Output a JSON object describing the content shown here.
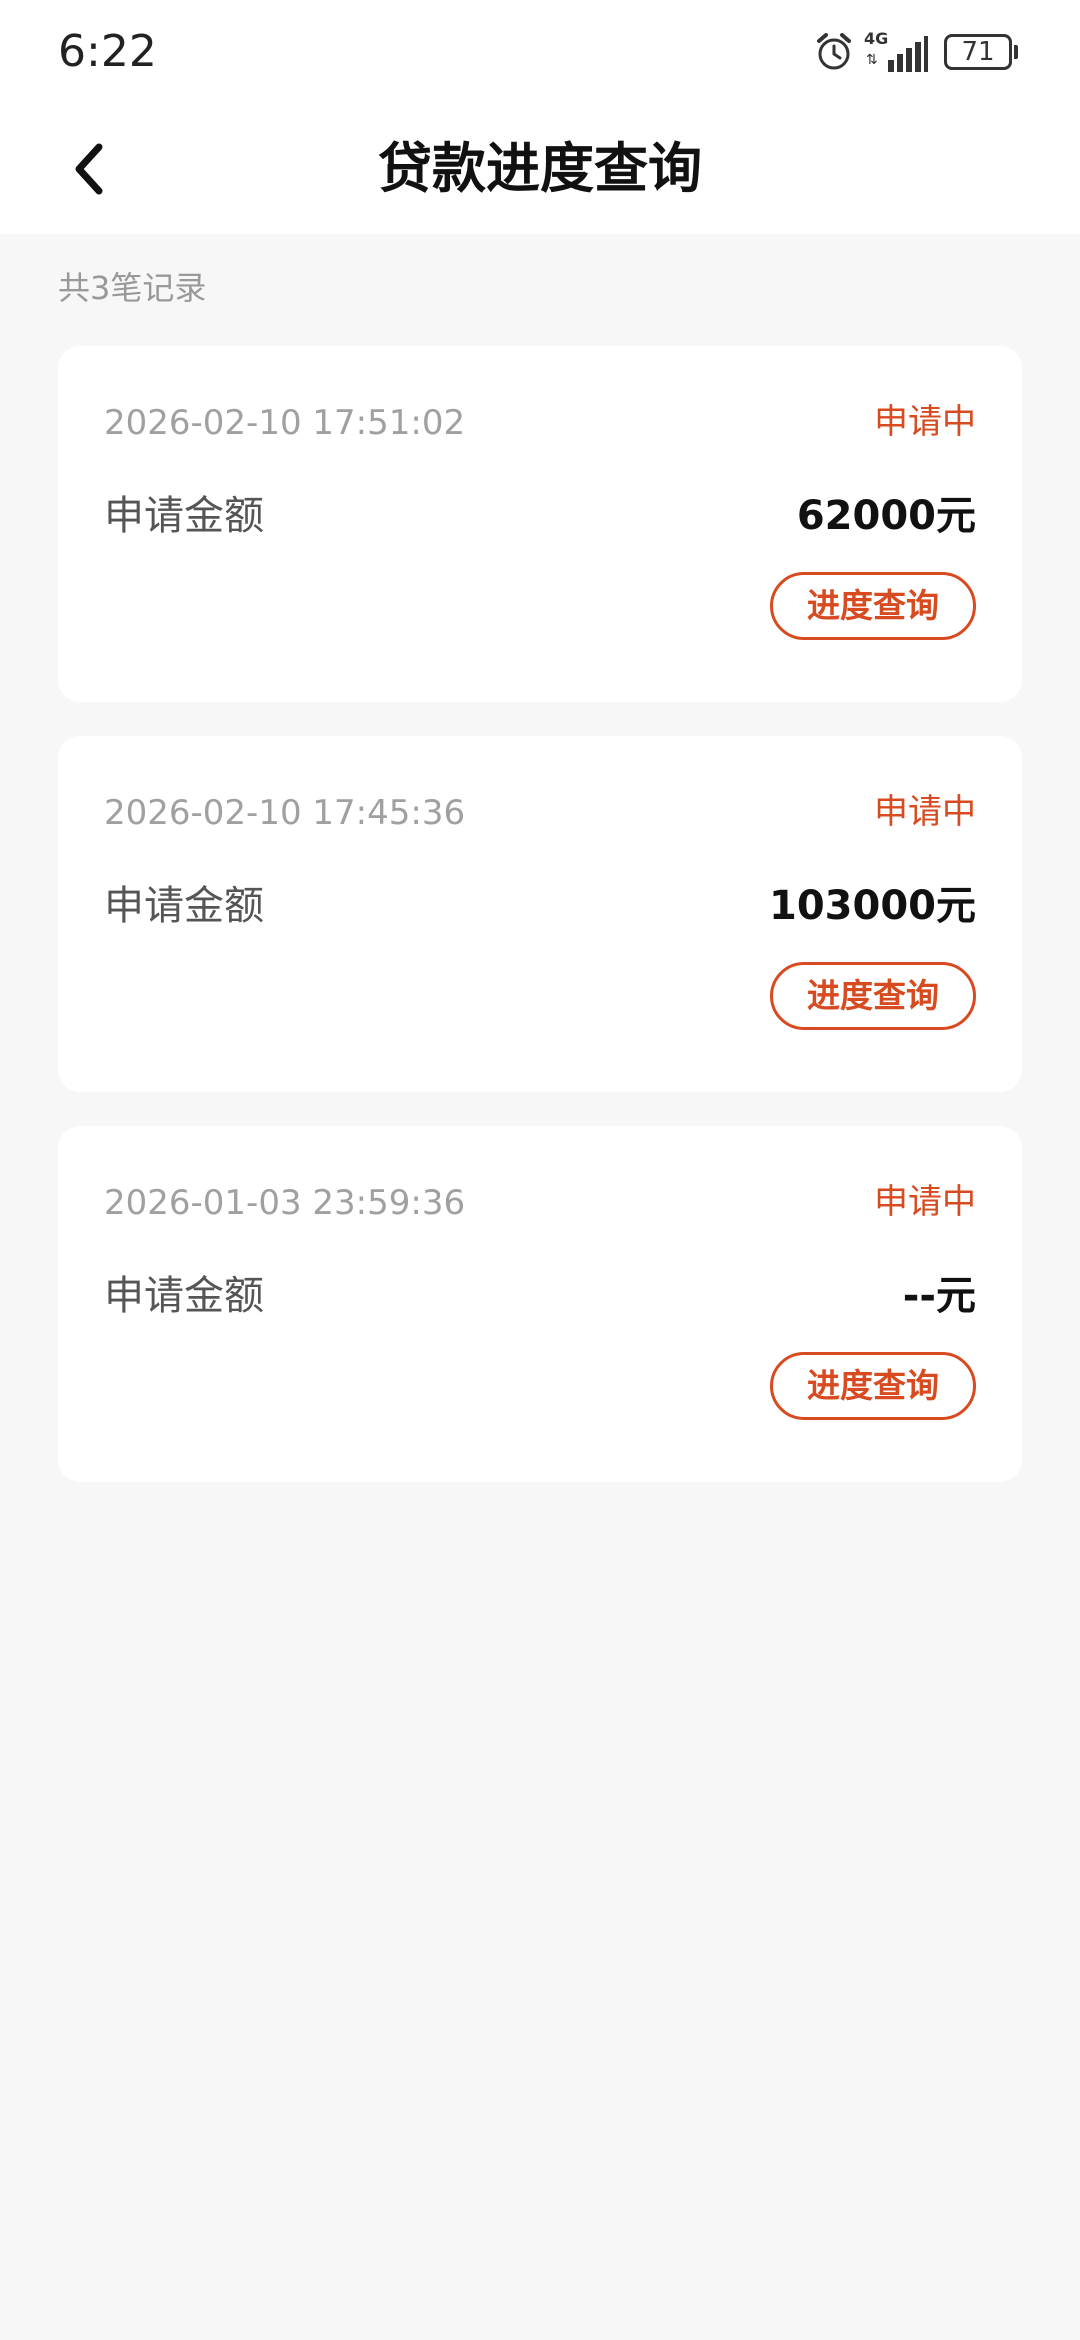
{
  "status_bar": {
    "time": "6:22",
    "network": "4G",
    "battery": "71"
  },
  "nav": {
    "title": "贷款进度查询"
  },
  "summary": {
    "record_count": "共3笔记录"
  },
  "records": [
    {
      "time": "2026-02-10 17:51:02",
      "status": "申请中",
      "label": "申请金额",
      "amount": "62000元",
      "button": "进度查询"
    },
    {
      "time": "2026-02-10 17:45:36",
      "status": "申请中",
      "label": "申请金额",
      "amount": "103000元",
      "button": "进度查询"
    },
    {
      "time": "2026-01-03 23:59:36",
      "status": "申请中",
      "label": "申请金额",
      "amount": "--元",
      "button": "进度查询"
    }
  ],
  "colors": {
    "accent": "#d84a1f",
    "background": "#f7f7f7",
    "card": "#ffffff"
  },
  "icons": [
    "alarm-icon",
    "signal-icon",
    "battery-icon",
    "back-arrow-icon"
  ]
}
